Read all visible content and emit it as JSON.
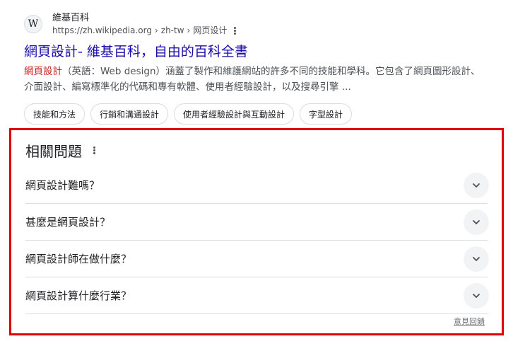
{
  "result": {
    "favicon_letter": "W",
    "site_name": "維基百科",
    "url_base": "https://zh.wikipedia.org",
    "url_sep": "›",
    "url_path_1": "zh-tw",
    "url_path_2": "网页设计",
    "title": "網頁設計- 維基百科，自由的百科全書",
    "snippet_highlight": "網頁設計",
    "snippet_rest": "（英語：Web design）涵蓋了製作和維護網站的許多不同的技能和學科。它包含了網頁圖形設計、介面設計、編寫標準化的代碼和專有軟體、使用者經驗設計，以及搜尋引擎 ...",
    "chips": [
      "技能和方法",
      "行銷和溝通設計",
      "使用者經驗設計與互動設計",
      "字型設計"
    ]
  },
  "paa": {
    "title": "相關問題",
    "questions": [
      "網頁設計難嗎？",
      "甚麼是網頁設計？",
      "網頁設計師在做什麼？",
      "網頁設計算什麼行業？"
    ],
    "feedback": "意見回饋"
  },
  "icons": {
    "more": "more-vert-icon",
    "expand": "chevron-down-icon"
  },
  "colors": {
    "link": "#1a0dab",
    "highlight": "#c5221f",
    "annotation_border": "#e00000"
  }
}
